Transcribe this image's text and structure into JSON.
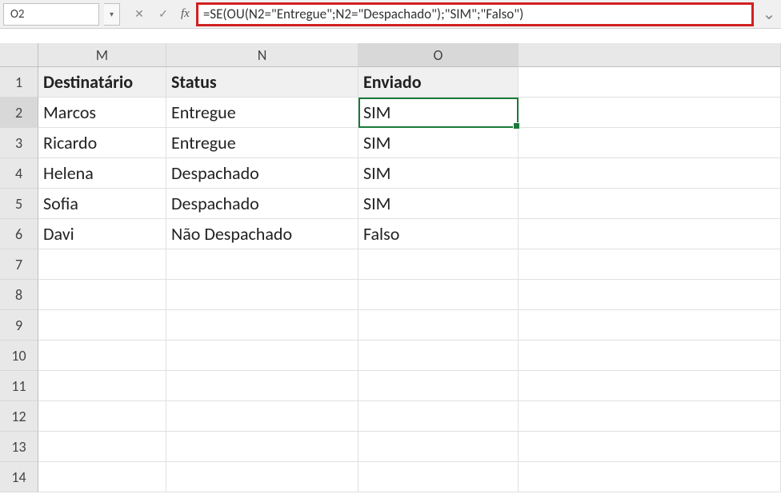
{
  "nameBox": "O2",
  "formula": "=SE(OU(N2=\"Entregue\";N2=\"Despachado\");\"SIM\";\"Falso\")",
  "fxLabel": "fx",
  "columns": [
    "M",
    "N",
    "O"
  ],
  "activeColumn": "O",
  "activeRow": "2",
  "rowNumbers": [
    "1",
    "2",
    "3",
    "4",
    "5",
    "6",
    "7",
    "8",
    "9",
    "10",
    "11",
    "12",
    "13",
    "14"
  ],
  "headerRow": {
    "M": "Destinatário",
    "N": "Status",
    "O": "Enviado"
  },
  "dataRows": [
    {
      "M": "Marcos",
      "N": "Entregue",
      "O": "SIM"
    },
    {
      "M": "Ricardo",
      "N": "Entregue",
      "O": "SIM"
    },
    {
      "M": "Helena",
      "N": "Despachado",
      "O": "SIM"
    },
    {
      "M": "Sofia",
      "N": "Despachado",
      "O": "SIM"
    },
    {
      "M": "Davi",
      "N": "Não Despachado",
      "O": "Falso"
    }
  ],
  "icons": {
    "dropdown": "▾",
    "cancel": "✕",
    "confirm": "✓",
    "expand": "⌄"
  }
}
